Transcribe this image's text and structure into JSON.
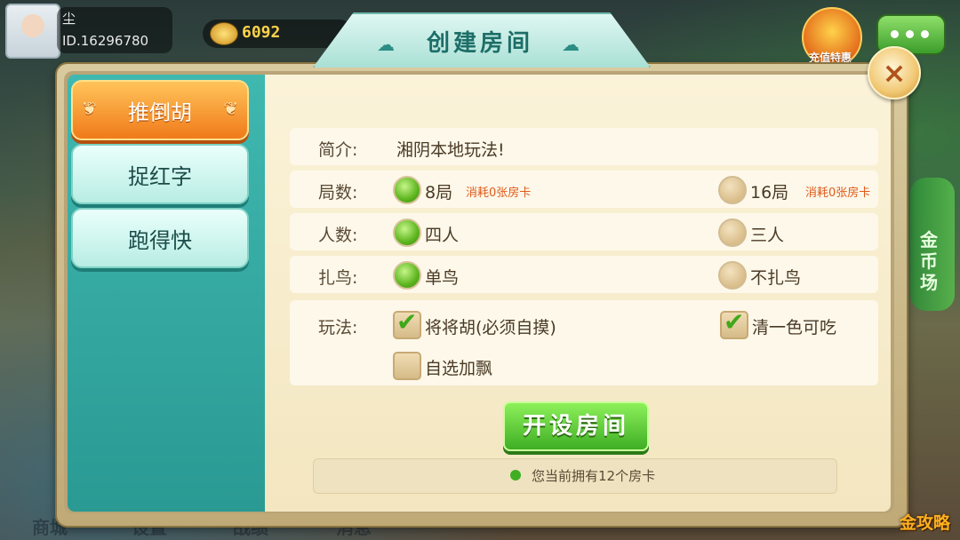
{
  "header": {
    "user_name": "尘",
    "user_id": "ID.16296780",
    "coins": "6092",
    "recharge_label": "充值特惠"
  },
  "side": {
    "gold_field": "金币场"
  },
  "bottom_menu": [
    "商城",
    "设置",
    "战绩",
    "消息"
  ],
  "dialog": {
    "title": "创建房间",
    "close_symbol": "×",
    "modes": [
      {
        "label": "推倒胡",
        "active": true
      },
      {
        "label": "捉红字",
        "active": false
      },
      {
        "label": "跑得快",
        "active": false
      }
    ],
    "intro": {
      "label": "简介:",
      "value": "湘阴本地玩法!"
    },
    "rounds": {
      "label": "局数:",
      "options": [
        {
          "label": "8局",
          "cost": "消耗0张房卡",
          "selected": true
        },
        {
          "label": "16局",
          "cost": "消耗0张房卡",
          "selected": false
        }
      ]
    },
    "players": {
      "label": "人数:",
      "options": [
        {
          "label": "四人",
          "selected": true
        },
        {
          "label": "三人",
          "selected": false
        }
      ]
    },
    "birds": {
      "label": "扎鸟:",
      "options": [
        {
          "label": "单鸟",
          "selected": true
        },
        {
          "label": "不扎鸟",
          "selected": false
        }
      ]
    },
    "rules": {
      "label": "玩法:",
      "options": [
        {
          "label": "将将胡(必须自摸)",
          "checked": true
        },
        {
          "label": "清一色可吃",
          "checked": true
        },
        {
          "label": "自选加飘",
          "checked": false
        }
      ]
    },
    "create_button": "开设房间",
    "card_info": "您当前拥有12个房卡"
  },
  "watermark": "金攻略",
  "colors": {
    "accent_teal": "#2a9a93",
    "active_orange": "#f07a1a",
    "selected_green": "#5cb51e",
    "cost_text": "#e05a1a"
  }
}
